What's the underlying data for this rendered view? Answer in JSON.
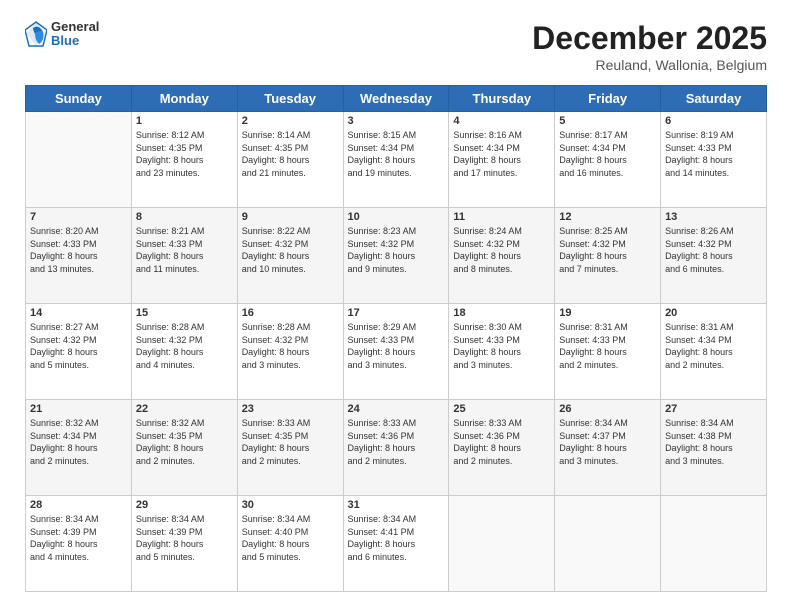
{
  "logo": {
    "general": "General",
    "blue": "Blue"
  },
  "header": {
    "month": "December 2025",
    "location": "Reuland, Wallonia, Belgium"
  },
  "weekdays": [
    "Sunday",
    "Monday",
    "Tuesday",
    "Wednesday",
    "Thursday",
    "Friday",
    "Saturday"
  ],
  "weeks": [
    [
      {
        "day": "",
        "info": ""
      },
      {
        "day": "1",
        "info": "Sunrise: 8:12 AM\nSunset: 4:35 PM\nDaylight: 8 hours\nand 23 minutes."
      },
      {
        "day": "2",
        "info": "Sunrise: 8:14 AM\nSunset: 4:35 PM\nDaylight: 8 hours\nand 21 minutes."
      },
      {
        "day": "3",
        "info": "Sunrise: 8:15 AM\nSunset: 4:34 PM\nDaylight: 8 hours\nand 19 minutes."
      },
      {
        "day": "4",
        "info": "Sunrise: 8:16 AM\nSunset: 4:34 PM\nDaylight: 8 hours\nand 17 minutes."
      },
      {
        "day": "5",
        "info": "Sunrise: 8:17 AM\nSunset: 4:34 PM\nDaylight: 8 hours\nand 16 minutes."
      },
      {
        "day": "6",
        "info": "Sunrise: 8:19 AM\nSunset: 4:33 PM\nDaylight: 8 hours\nand 14 minutes."
      }
    ],
    [
      {
        "day": "7",
        "info": "Sunrise: 8:20 AM\nSunset: 4:33 PM\nDaylight: 8 hours\nand 13 minutes."
      },
      {
        "day": "8",
        "info": "Sunrise: 8:21 AM\nSunset: 4:33 PM\nDaylight: 8 hours\nand 11 minutes."
      },
      {
        "day": "9",
        "info": "Sunrise: 8:22 AM\nSunset: 4:32 PM\nDaylight: 8 hours\nand 10 minutes."
      },
      {
        "day": "10",
        "info": "Sunrise: 8:23 AM\nSunset: 4:32 PM\nDaylight: 8 hours\nand 9 minutes."
      },
      {
        "day": "11",
        "info": "Sunrise: 8:24 AM\nSunset: 4:32 PM\nDaylight: 8 hours\nand 8 minutes."
      },
      {
        "day": "12",
        "info": "Sunrise: 8:25 AM\nSunset: 4:32 PM\nDaylight: 8 hours\nand 7 minutes."
      },
      {
        "day": "13",
        "info": "Sunrise: 8:26 AM\nSunset: 4:32 PM\nDaylight: 8 hours\nand 6 minutes."
      }
    ],
    [
      {
        "day": "14",
        "info": "Sunrise: 8:27 AM\nSunset: 4:32 PM\nDaylight: 8 hours\nand 5 minutes."
      },
      {
        "day": "15",
        "info": "Sunrise: 8:28 AM\nSunset: 4:32 PM\nDaylight: 8 hours\nand 4 minutes."
      },
      {
        "day": "16",
        "info": "Sunrise: 8:28 AM\nSunset: 4:32 PM\nDaylight: 8 hours\nand 3 minutes."
      },
      {
        "day": "17",
        "info": "Sunrise: 8:29 AM\nSunset: 4:33 PM\nDaylight: 8 hours\nand 3 minutes."
      },
      {
        "day": "18",
        "info": "Sunrise: 8:30 AM\nSunset: 4:33 PM\nDaylight: 8 hours\nand 3 minutes."
      },
      {
        "day": "19",
        "info": "Sunrise: 8:31 AM\nSunset: 4:33 PM\nDaylight: 8 hours\nand 2 minutes."
      },
      {
        "day": "20",
        "info": "Sunrise: 8:31 AM\nSunset: 4:34 PM\nDaylight: 8 hours\nand 2 minutes."
      }
    ],
    [
      {
        "day": "21",
        "info": "Sunrise: 8:32 AM\nSunset: 4:34 PM\nDaylight: 8 hours\nand 2 minutes."
      },
      {
        "day": "22",
        "info": "Sunrise: 8:32 AM\nSunset: 4:35 PM\nDaylight: 8 hours\nand 2 minutes."
      },
      {
        "day": "23",
        "info": "Sunrise: 8:33 AM\nSunset: 4:35 PM\nDaylight: 8 hours\nand 2 minutes."
      },
      {
        "day": "24",
        "info": "Sunrise: 8:33 AM\nSunset: 4:36 PM\nDaylight: 8 hours\nand 2 minutes."
      },
      {
        "day": "25",
        "info": "Sunrise: 8:33 AM\nSunset: 4:36 PM\nDaylight: 8 hours\nand 2 minutes."
      },
      {
        "day": "26",
        "info": "Sunrise: 8:34 AM\nSunset: 4:37 PM\nDaylight: 8 hours\nand 3 minutes."
      },
      {
        "day": "27",
        "info": "Sunrise: 8:34 AM\nSunset: 4:38 PM\nDaylight: 8 hours\nand 3 minutes."
      }
    ],
    [
      {
        "day": "28",
        "info": "Sunrise: 8:34 AM\nSunset: 4:39 PM\nDaylight: 8 hours\nand 4 minutes."
      },
      {
        "day": "29",
        "info": "Sunrise: 8:34 AM\nSunset: 4:39 PM\nDaylight: 8 hours\nand 5 minutes."
      },
      {
        "day": "30",
        "info": "Sunrise: 8:34 AM\nSunset: 4:40 PM\nDaylight: 8 hours\nand 5 minutes."
      },
      {
        "day": "31",
        "info": "Sunrise: 8:34 AM\nSunset: 4:41 PM\nDaylight: 8 hours\nand 6 minutes."
      },
      {
        "day": "",
        "info": ""
      },
      {
        "day": "",
        "info": ""
      },
      {
        "day": "",
        "info": ""
      }
    ]
  ]
}
